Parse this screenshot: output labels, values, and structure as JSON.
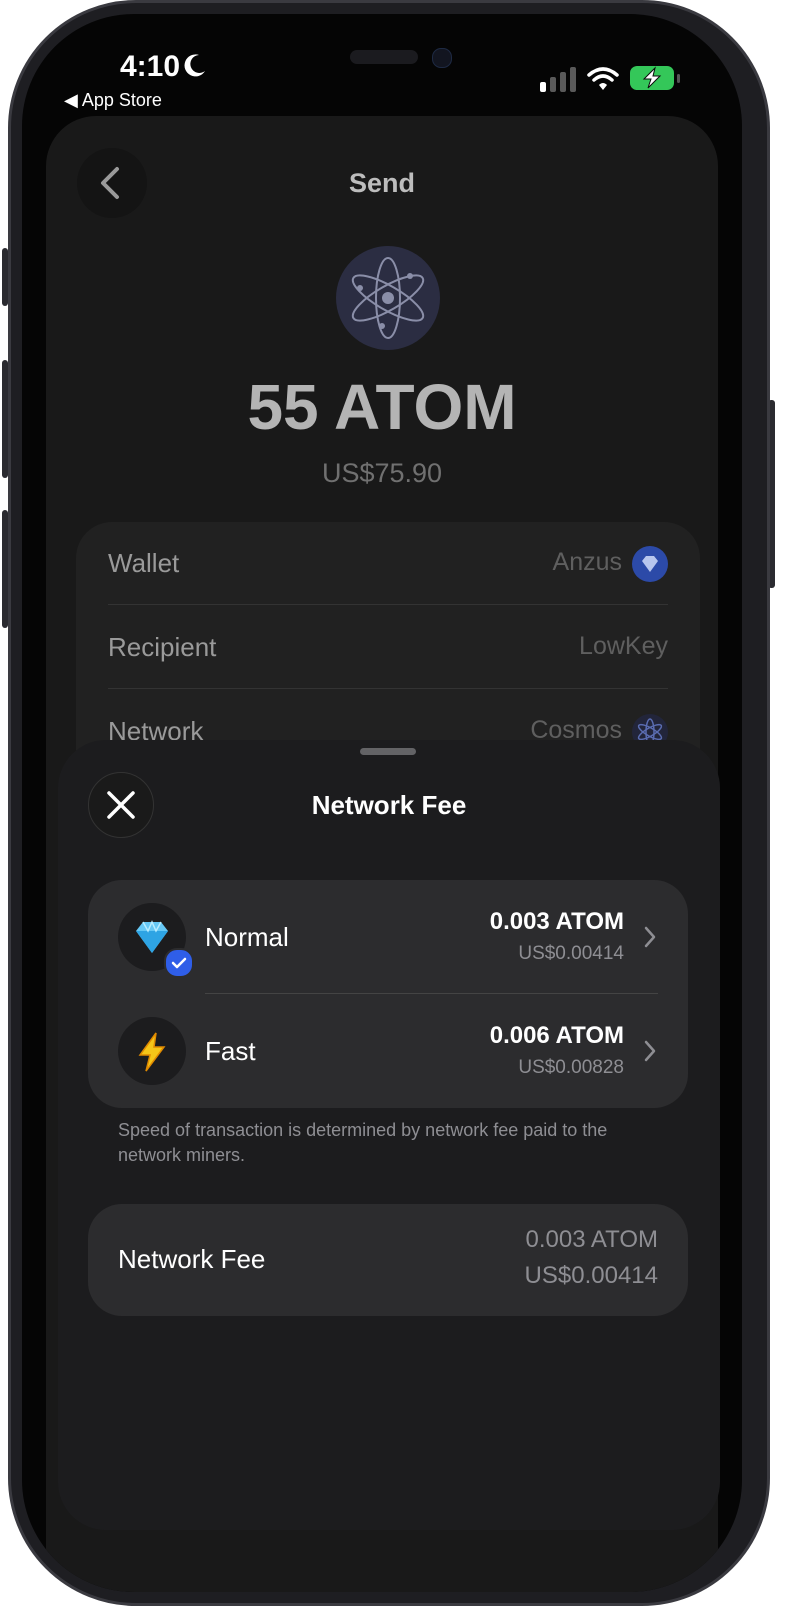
{
  "status_bar": {
    "time": "4:10",
    "back_label": "◀ App Store"
  },
  "header": {
    "title": "Send"
  },
  "amount": {
    "crypto": "55 ATOM",
    "fiat": "US$75.90"
  },
  "details": [
    {
      "label": "Wallet",
      "value": "Anzus"
    },
    {
      "label": "Recipient",
      "value": "LowKey"
    },
    {
      "label": "Network",
      "value": "Cosmos"
    }
  ],
  "sheet": {
    "title": "Network Fee",
    "options": [
      {
        "name": "Normal",
        "amount": "0.003 ATOM",
        "fiat": "US$0.00414",
        "icon": "gem-icon",
        "selected": true
      },
      {
        "name": "Fast",
        "amount": "0.006 ATOM",
        "fiat": "US$0.00828",
        "icon": "lightning-icon",
        "selected": false
      }
    ],
    "note": "Speed of transaction is determined by network fee paid to the network miners.",
    "summary": {
      "label": "Network Fee",
      "amount": "0.003 ATOM",
      "fiat": "US$0.00414"
    }
  },
  "colors": {
    "accent": "#2f5ee8",
    "battery": "#34c759",
    "cosmos": "#2b2d42"
  }
}
